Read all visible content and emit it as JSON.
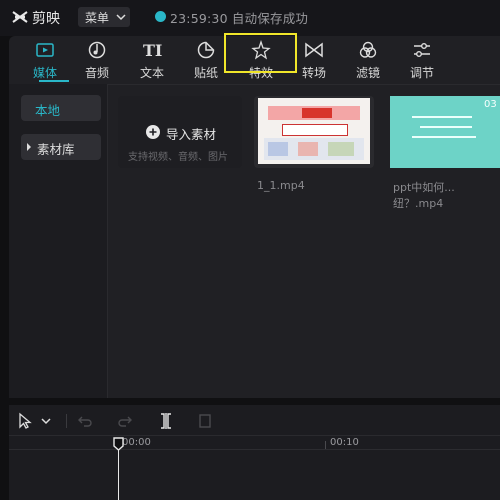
{
  "titlebar": {
    "app_name": "剪映",
    "menu_label": "菜单",
    "save_status": "23:59:30 自动保存成功"
  },
  "toolbar": {
    "tools": [
      {
        "label": "媒体",
        "icon": "media-play-icon",
        "active": true
      },
      {
        "label": "音频",
        "icon": "music-note-icon"
      },
      {
        "label": "文本",
        "icon": "text-ti-icon"
      },
      {
        "label": "贴纸",
        "icon": "sticker-icon"
      },
      {
        "label": "特效",
        "icon": "sparkle-star-icon",
        "highlighted": true
      },
      {
        "label": "转场",
        "icon": "bowtie-transition-icon"
      },
      {
        "label": "滤镜",
        "icon": "filter-circles-icon"
      },
      {
        "label": "调节",
        "icon": "sliders-icon"
      }
    ]
  },
  "sidebar": {
    "items": [
      {
        "label": "本地",
        "active": true
      },
      {
        "label": "素材库"
      }
    ]
  },
  "media": {
    "import_label": "导入素材",
    "import_sub": "支持视频、音频、图片",
    "items": [
      {
        "label": "1_1.mp4"
      },
      {
        "label": "ppt中如何...纽？.mp4",
        "corner": "03"
      }
    ]
  },
  "timeline": {
    "ticks": [
      "00:00",
      "00:10"
    ]
  },
  "colors": {
    "accent": "#2ab7c8",
    "highlight_box": "#f0e62a",
    "panel_bg": "#202024",
    "app_bg": "#101012"
  }
}
